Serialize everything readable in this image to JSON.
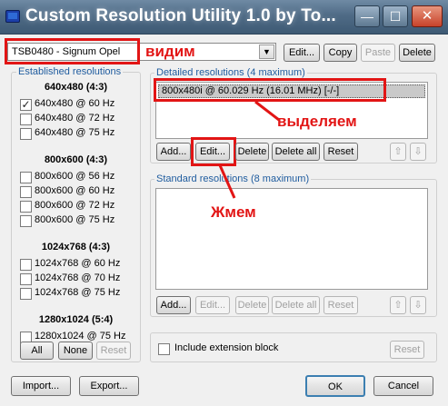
{
  "window": {
    "title": "Custom Resolution Utility 1.0 by To...",
    "minimize": "—",
    "maximize": "☐",
    "close": "✕"
  },
  "top": {
    "display_select": "TSB0480 - Signum Opel",
    "edit": "Edit...",
    "copy": "Copy",
    "paste": "Paste",
    "delete": "Delete"
  },
  "established": {
    "group_label": "Established resolutions",
    "sections": [
      {
        "title": "640x480 (4:3)",
        "items": [
          {
            "label": "640x480 @ 60 Hz",
            "checked": true
          },
          {
            "label": "640x480 @ 72 Hz",
            "checked": false
          },
          {
            "label": "640x480 @ 75 Hz",
            "checked": false
          }
        ]
      },
      {
        "title": "800x600 (4:3)",
        "items": [
          {
            "label": "800x600 @ 56 Hz",
            "checked": false
          },
          {
            "label": "800x600 @ 60 Hz",
            "checked": false
          },
          {
            "label": "800x600 @ 72 Hz",
            "checked": false
          },
          {
            "label": "800x600 @ 75 Hz",
            "checked": false
          }
        ]
      },
      {
        "title": "1024x768 (4:3)",
        "items": [
          {
            "label": "1024x768 @ 60 Hz",
            "checked": false
          },
          {
            "label": "1024x768 @ 70 Hz",
            "checked": false
          },
          {
            "label": "1024x768 @ 75 Hz",
            "checked": false
          }
        ]
      },
      {
        "title": "1280x1024 (5:4)",
        "items": [
          {
            "label": "1280x1024 @ 75 Hz",
            "checked": false
          }
        ]
      }
    ],
    "all": "All",
    "none": "None",
    "reset": "Reset"
  },
  "detailed": {
    "group_label": "Detailed resolutions (4 maximum)",
    "items": [
      "800x480i @ 60.029 Hz (16.01 MHz) [-/-]"
    ],
    "add": "Add...",
    "edit": "Edit...",
    "delete": "Delete",
    "delete_all": "Delete all",
    "reset": "Reset",
    "up": "⇧",
    "down": "⇩"
  },
  "standard": {
    "group_label": "Standard resolutions (8 maximum)",
    "add": "Add...",
    "edit": "Edit...",
    "delete": "Delete",
    "delete_all": "Delete all",
    "reset": "Reset",
    "up": "⇧",
    "down": "⇩"
  },
  "extension": {
    "checkbox_label": "Include extension block",
    "reset": "Reset"
  },
  "footer": {
    "import": "Import...",
    "export": "Export...",
    "ok": "OK",
    "cancel": "Cancel"
  },
  "annotations": {
    "vidim": "видим",
    "vydelyaem": "выделяем",
    "zhmem": "Жмем"
  },
  "colors": {
    "annotation_red": "#e21515",
    "selection_gray": "#c9c9c9",
    "group_label_blue": "#1e5b9e"
  }
}
